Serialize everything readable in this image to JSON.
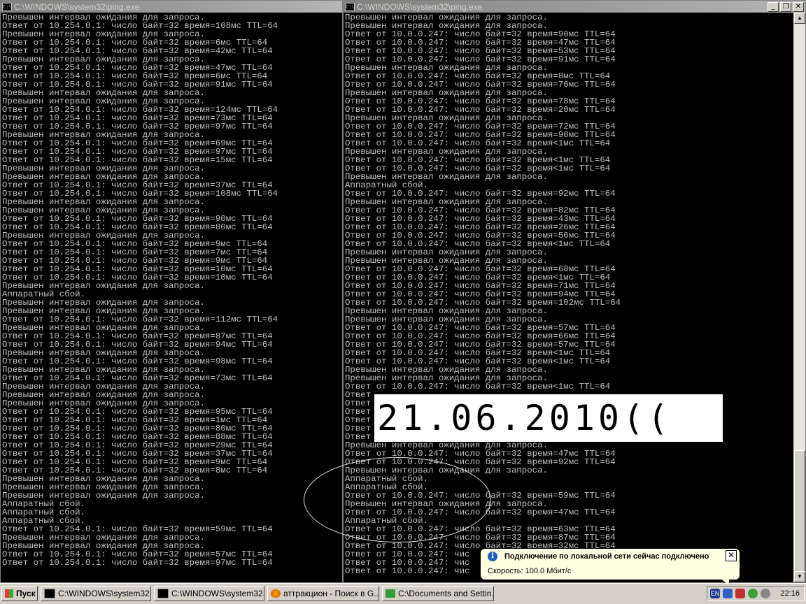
{
  "left_window": {
    "title": "C:\\WINDOWS\\system32\\ping.exe",
    "lines": [
      "Превышен интервал ожидания для запроса.",
      "Ответ от 10.254.0.1: число байт=32 время=108мс TTL=64",
      "Превышен интервал ожидания для запроса.",
      "Ответ от 10.254.0.1: число байт=32 время=6мс TTL=64",
      "Ответ от 10.254.0.1: число байт=32 время=42мс TTL=64",
      "Превышен интервал ожидания для запроса.",
      "Ответ от 10.254.0.1: число байт=32 время=47мс TTL=64",
      "Ответ от 10.254.0.1: число байт=32 время=6мс TTL=64",
      "Ответ от 10.254.0.1: число байт=32 время=91мс TTL=64",
      "Превышен интервал ожидания для запроса.",
      "Превышен интервал ожидания для запроса.",
      "Ответ от 10.254.0.1: число байт=32 время=124мс TTL=64",
      "Ответ от 10.254.0.1: число байт=32 время=73мс TTL=64",
      "Ответ от 10.254.0.1: число байт=32 время=97мс TTL=64",
      "Превышен интервал ожидания для запроса.",
      "Ответ от 10.254.0.1: число байт=32 время=69мс TTL=64",
      "Ответ от 10.254.0.1: число байт=32 время=97мс TTL=64",
      "Ответ от 10.254.0.1: число байт=32 время=15мс TTL=64",
      "Превышен интервал ожидания для запроса.",
      "Превышен интервал ожидания для запроса.",
      "Ответ от 10.254.0.1: число байт=32 время=37мс TTL=64",
      "Ответ от 10.254.0.1: число байт=32 время=108мс TTL=64",
      "Превышен интервал ожидания для запроса.",
      "Превышен интервал ожидания для запроса.",
      "Ответ от 10.254.0.1: число байт=32 время=90мс TTL=64",
      "Ответ от 10.254.0.1: число байт=32 время=80мс TTL=64",
      "Превышен интервал ожидания для запроса.",
      "Ответ от 10.254.0.1: число байт=32 время=9мс TTL=64",
      "Ответ от 10.254.0.1: число байт=32 время=7мс TTL=64",
      "Ответ от 10.254.0.1: число байт=32 время=9мс TTL=64",
      "Ответ от 10.254.0.1: число байт=32 время=10мс TTL=64",
      "Ответ от 10.254.0.1: число байт=32 время=10мс TTL=64",
      "Превышен интервал ожидания для запроса.",
      "Аппаратный сбой.",
      "Превышен интервал ожидания для запроса.",
      "Превышен интервал ожидания для запроса.",
      "Ответ от 10.254.0.1: число байт=32 время=112мс TTL=64",
      "Превышен интервал ожидания для запроса.",
      "Ответ от 10.254.0.1: число байт=32 время=87мс TTL=64",
      "Ответ от 10.254.0.1: число байт=32 время=94мс TTL=64",
      "Превышен интервал ожидания для запроса.",
      "Ответ от 10.254.0.1: число байт=32 время=98мс TTL=64",
      "Превышен интервал ожидания для запроса.",
      "Ответ от 10.254.0.1: число байт=32 время=73мс TTL=64",
      "Превышен интервал ожидания для запроса.",
      "Превышен интервал ожидания для запроса.",
      "Превышен интервал ожидания для запроса.",
      "Ответ от 10.254.0.1: число байт=32 время=95мс TTL=64",
      "Ответ от 10.254.0.1: число байт=32 время=1мс TTL=64",
      "Ответ от 10.254.0.1: число байт=32 время=80мс TTL=64",
      "Ответ от 10.254.0.1: число байт=32 время=88мс TTL=64",
      "Ответ от 10.254.0.1: число байт=32 время=29мс TTL=64",
      "Ответ от 10.254.0.1: число байт=32 время=37мс TTL=64",
      "Ответ от 10.254.0.1: число байт=32 время=9мс TTL=64",
      "Ответ от 10.254.0.1: число байт=32 время=8мс TTL=64",
      "Превышен интервал ожидания для запроса.",
      "Превышен интервал ожидания для запроса.",
      "Превышен интервал ожидания для запроса.",
      "Аппаратный сбой.",
      "Аппаратный сбой.",
      "Аппаратный сбой.",
      "Ответ от 10.254.0.1: число байт=32 время=59мс TTL=64",
      "Превышен интервал ожидания для запроса.",
      "Превышен интервал ожидания для запроса.",
      "Ответ от 10.254.0.1: число байт=32 время=57мс TTL=64",
      "Ответ от 10.254.0.1: число байт=32 время=97мс TTL=64"
    ]
  },
  "right_window": {
    "title": "C:\\WINDOWS\\system32\\ping.exe",
    "lines": [
      "Превышен интервал ожидания для запроса.",
      "Превышен интервал ожидания для запроса.",
      "Ответ от 10.0.0.247: число байт=32 время=90мс TTL=64",
      "Ответ от 10.0.0.247: число байт=32 время=47мс TTL=64",
      "Ответ от 10.0.0.247: число байт=32 время=53мс TTL=64",
      "Ответ от 10.0.0.247: число байт=32 время=91мс TTL=64",
      "Превышен интервал ожидания для запроса.",
      "Ответ от 10.0.0.247: число байт=32 время=8мс TTL=64",
      "Ответ от 10.0.0.247: число байт=32 время=76мс TTL=64",
      "Превышен интервал ожидания для запроса.",
      "Ответ от 10.0.0.247: число байт=32 время=78мс TTL=64",
      "Ответ от 10.0.0.247: число байт=32 время=20мс TTL=64",
      "Превышен интервал ожидания для запроса.",
      "Ответ от 10.0.0.247: число байт=32 время=72мс TTL=64",
      "Ответ от 10.0.0.247: число байт=32 время=98мс TTL=64",
      "Ответ от 10.0.0.247: число байт=32 время<1мс TTL=64",
      "Превышен интервал ожидания для запроса.",
      "Ответ от 10.0.0.247: число байт=32 время<1мс TTL=64",
      "Ответ от 10.0.0.247: число байт=32 время<1мс TTL=64",
      "Превышен интервал ожидания для запроса.",
      "Аппаратный сбой.",
      "Ответ от 10.0.0.247: число байт=32 время=92мс TTL=64",
      "Превышен интервал ожидания для запроса.",
      "Ответ от 10.0.0.247: число байт=32 время=82мс TTL=64",
      "Ответ от 10.0.0.247: число байт=32 время=43мс TTL=64",
      "Ответ от 10.0.0.247: число байт=32 время=26мс TTL=64",
      "Ответ от 10.0.0.247: число байт=32 время=56мс TTL=64",
      "Ответ от 10.0.0.247: число байт=32 время<1мс TTL=64",
      "Превышен интервал ожидания для запроса.",
      "Превышен интервал ожидания для запроса.",
      "Ответ от 10.0.0.247: число байт=32 время=68мс TTL=64",
      "Ответ от 10.0.0.247: число байт=32 время<1мс TTL=64",
      "Ответ от 10.0.0.247: число байт=32 время=71мс TTL=64",
      "Ответ от 10.0.0.247: число байт=32 время=94мс TTL=64",
      "Ответ от 10.0.0.247: число байт=32 время=102мс TTL=64",
      "Превышен интервал ожидания для запроса.",
      "Превышен интервал ожидания для запроса.",
      "Ответ от 10.0.0.247: число байт=32 время=57мс TTL=64",
      "Ответ от 10.0.0.247: число байт=32 время=66мс TTL=64",
      "Ответ от 10.0.0.247: число байт=32 время=57мс TTL=64",
      "Ответ от 10.0.0.247: число байт=32 время<1мс TTL=64",
      "Ответ от 10.0.0.247: число байт=32 время<1мс TTL=64",
      "Превышен интервал ожидания для запроса.",
      "Превышен интервал ожидания для запроса.",
      "Ответ от 10.0.0.247: число байт=32 время<1мс TTL=64",
      "Ответ",
      "Ответ",
      "Ответ",
      "Ответ",
      "Ответ",
      "Ответ",
      "Превышен интервал ожидания для запроса.",
      "Ответ от 10.0.0.247: число байт=32 время=47мс TTL=64",
      "Ответ от 10.0.0.247: число байт=32 время=92мс TTL=64",
      "Превышен интервал ожидания для запроса.",
      "Аппаратный сбой.",
      "Аппаратный сбой.",
      "Ответ от 10.0.0.247: число байт=32 время=59мс TTL=64",
      "Превышен интервал ожидания для запроса.",
      "Ответ от 10.0.0.247: число байт=32 время=47мс TTL=64",
      "Аппаратный сбой.",
      "Ответ от 10.0.0.247: число байт=32 время=63мс TTL=64",
      "Ответ от 10.0.0.247: число байт=32 время=87мс TTL=64",
      "Ответ от 10.0.0.247: число байт=32 время=32мс TTL=64",
      "Ответ от 10.0.0.247: чис",
      "Ответ от 10.0.0.247: чис",
      "Ответ от 10.0.0.247: чис"
    ]
  },
  "overlay_date": "21.06.2010((",
  "balloon": {
    "title": "Подключение по локальной сети сейчас подключено",
    "text": "Скорость: 100.0 Мбит/с",
    "close": "✕"
  },
  "taskbar": {
    "start_label": "Пуск",
    "tasks": [
      "C:\\WINDOWS\\system32...",
      "C:\\WINDOWS\\system32...",
      "аттракцион - Поиск в G...",
      "C:\\Documents and Settin..."
    ],
    "lang": "EN",
    "clock": "22:16"
  },
  "colors": {
    "console_bg": "#000000",
    "console_text": "#c0c0c0",
    "taskbar": "#d4d0c8",
    "balloon_bg": "#ffffe1"
  }
}
